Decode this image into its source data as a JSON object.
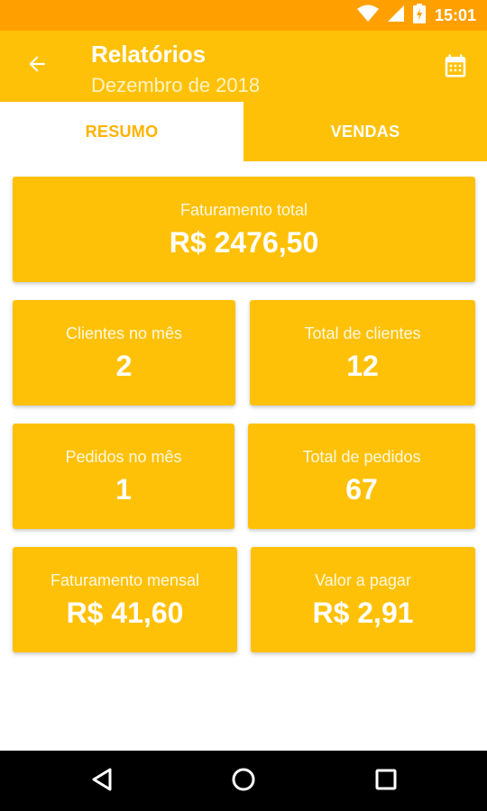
{
  "status_bar": {
    "time": "15:01"
  },
  "app_bar": {
    "title": "Relatórios",
    "subtitle": "Dezembro de 2018"
  },
  "tabs": [
    {
      "label": "RESUMO",
      "active": true
    },
    {
      "label": "VENDAS",
      "active": false
    }
  ],
  "cards": {
    "faturamento_total": {
      "label": "Faturamento total",
      "value": "R$ 2476,50"
    },
    "clientes_no_mes": {
      "label": "Clientes no mês",
      "value": "2"
    },
    "total_de_clientes": {
      "label": "Total de clientes",
      "value": "12"
    },
    "pedidos_no_mes": {
      "label": "Pedidos no mês",
      "value": "1"
    },
    "total_de_pedidos": {
      "label": "Total de pedidos",
      "value": "67"
    },
    "faturamento_mensal": {
      "label": "Faturamento mensal",
      "value": "R$ 41,60"
    },
    "valor_a_pagar": {
      "label": "Valor a pagar",
      "value": "R$ 2,91"
    }
  },
  "icons": {
    "back": "arrow-back-icon",
    "calendar": "calendar-icon",
    "wifi": "wifi-icon",
    "signal": "signal-icon",
    "battery": "battery-charging-icon",
    "nav_back": "triangle-back-icon",
    "nav_home": "circle-home-icon",
    "nav_recents": "square-recents-icon"
  },
  "colors": {
    "primary": "#FFC107",
    "primary_dark": "#FFA000",
    "tab_active_text": "#FFB300"
  }
}
